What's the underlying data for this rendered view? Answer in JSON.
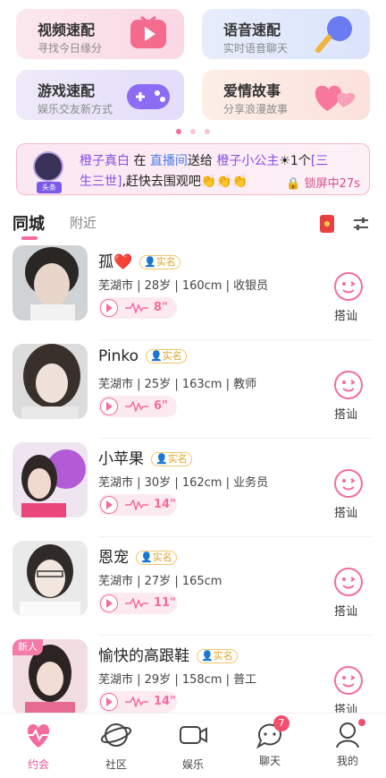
{
  "cards": [
    {
      "title": "视频速配",
      "subtitle": "寻找今日缘分",
      "icon": "video-tv-icon"
    },
    {
      "title": "语音速配",
      "subtitle": "实时语音聊天",
      "icon": "microphone-icon"
    },
    {
      "title": "游戏速配",
      "subtitle": "娱乐交友新方式",
      "icon": "gamepad-icon"
    },
    {
      "title": "爱情故事",
      "subtitle": "分享浪漫故事",
      "icon": "hearts-icon"
    }
  ],
  "banner": {
    "badge_tag": "头条",
    "sender": "橙子真白",
    "in_text": "在",
    "room": "直播间",
    "sent_text": "送给",
    "receiver": "橙子小公主",
    "gift_prefix": "1个",
    "gift_open": "[三",
    "gift_close": "生三世]",
    "cta": ",赶快去围观吧",
    "claps": "👏👏👏",
    "lock_text": "锁屏中27s"
  },
  "tabs": {
    "active": "同城",
    "inactive": "附近"
  },
  "realname_label": "实名",
  "chat_label": "搭讪",
  "users": [
    {
      "name": "孤",
      "heart": "❤️",
      "info": "芜湖市 | 28岁 | 160cm | 收银员",
      "duration": "8\"",
      "new": false
    },
    {
      "name": "Pinko",
      "heart": "",
      "info": "芜湖市 | 25岁 | 163cm | 教师",
      "duration": "6\"",
      "new": false
    },
    {
      "name": "小苹果",
      "heart": "",
      "info": "芜湖市 | 30岁 | 162cm | 业务员",
      "duration": "14\"",
      "new": false
    },
    {
      "name": "恩宠",
      "heart": "",
      "info": "芜湖市 | 27岁 | 165cm",
      "duration": "11\"",
      "new": false
    },
    {
      "name": "愉快的高跟鞋",
      "heart": "",
      "info": "芜湖市 | 29岁 | 158cm | 普工",
      "duration": "14\"",
      "new": true,
      "new_label": "新人"
    }
  ],
  "nav": [
    {
      "label": "约会",
      "icon": "heart-pulse-icon",
      "active": true
    },
    {
      "label": "社区",
      "icon": "planet-icon",
      "active": false
    },
    {
      "label": "娱乐",
      "icon": "video-camera-icon",
      "active": false
    },
    {
      "label": "聊天",
      "icon": "chat-bubble-icon",
      "active": false,
      "badge": "7"
    },
    {
      "label": "我的",
      "icon": "profile-icon",
      "active": false,
      "dot": true
    }
  ],
  "colors": {
    "accent": "#f05a95",
    "pink_light": "#fde9f0",
    "realname": "#e0a42a"
  }
}
